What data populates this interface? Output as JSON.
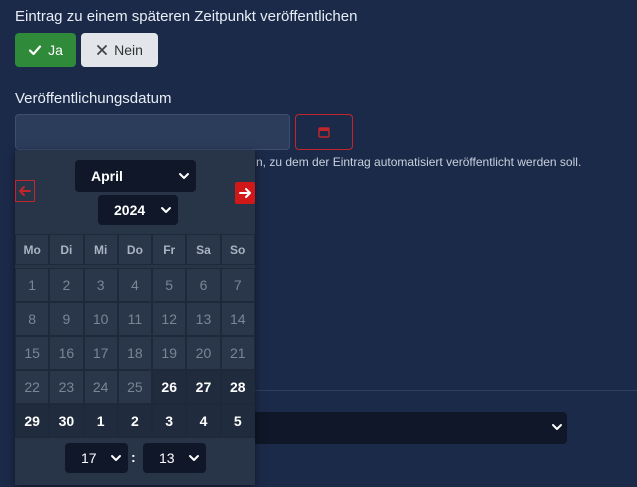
{
  "publish_later": {
    "label": "Eintrag zu einem späteren Zeitpunkt veröffentlichen",
    "yes_label": "Ja",
    "no_label": "Nein"
  },
  "publish_date": {
    "label": "Veröffentlichungsdatum",
    "value": "",
    "help_text": "n, zu dem der Eintrag automatisiert veröffentlicht werden soll."
  },
  "datepicker": {
    "month": "April",
    "year": "2024",
    "weekdays": [
      "Mo",
      "Di",
      "Mi",
      "Do",
      "Fr",
      "Sa",
      "So"
    ],
    "weeks": [
      [
        {
          "d": "1",
          "a": false
        },
        {
          "d": "2",
          "a": false
        },
        {
          "d": "3",
          "a": false
        },
        {
          "d": "4",
          "a": false
        },
        {
          "d": "5",
          "a": false
        },
        {
          "d": "6",
          "a": false
        },
        {
          "d": "7",
          "a": false
        }
      ],
      [
        {
          "d": "8",
          "a": false
        },
        {
          "d": "9",
          "a": false
        },
        {
          "d": "10",
          "a": false
        },
        {
          "d": "11",
          "a": false
        },
        {
          "d": "12",
          "a": false
        },
        {
          "d": "13",
          "a": false
        },
        {
          "d": "14",
          "a": false
        }
      ],
      [
        {
          "d": "15",
          "a": false
        },
        {
          "d": "16",
          "a": false
        },
        {
          "d": "17",
          "a": false
        },
        {
          "d": "18",
          "a": false
        },
        {
          "d": "19",
          "a": false
        },
        {
          "d": "20",
          "a": false
        },
        {
          "d": "21",
          "a": false
        }
      ],
      [
        {
          "d": "22",
          "a": false
        },
        {
          "d": "23",
          "a": false
        },
        {
          "d": "24",
          "a": false
        },
        {
          "d": "25",
          "a": false
        },
        {
          "d": "26",
          "a": true
        },
        {
          "d": "27",
          "a": true
        },
        {
          "d": "28",
          "a": true
        }
      ],
      [
        {
          "d": "29",
          "a": true
        },
        {
          "d": "30",
          "a": true
        },
        {
          "d": "1",
          "a": true
        },
        {
          "d": "2",
          "a": true
        },
        {
          "d": "3",
          "a": true
        },
        {
          "d": "4",
          "a": true
        },
        {
          "d": "5",
          "a": true
        }
      ]
    ],
    "hour": "17",
    "minute": "13",
    "time_separator": ":"
  },
  "colors": {
    "accent_red": "#d01818",
    "success_green": "#2f8a3a",
    "background": "#1c2a4a"
  }
}
